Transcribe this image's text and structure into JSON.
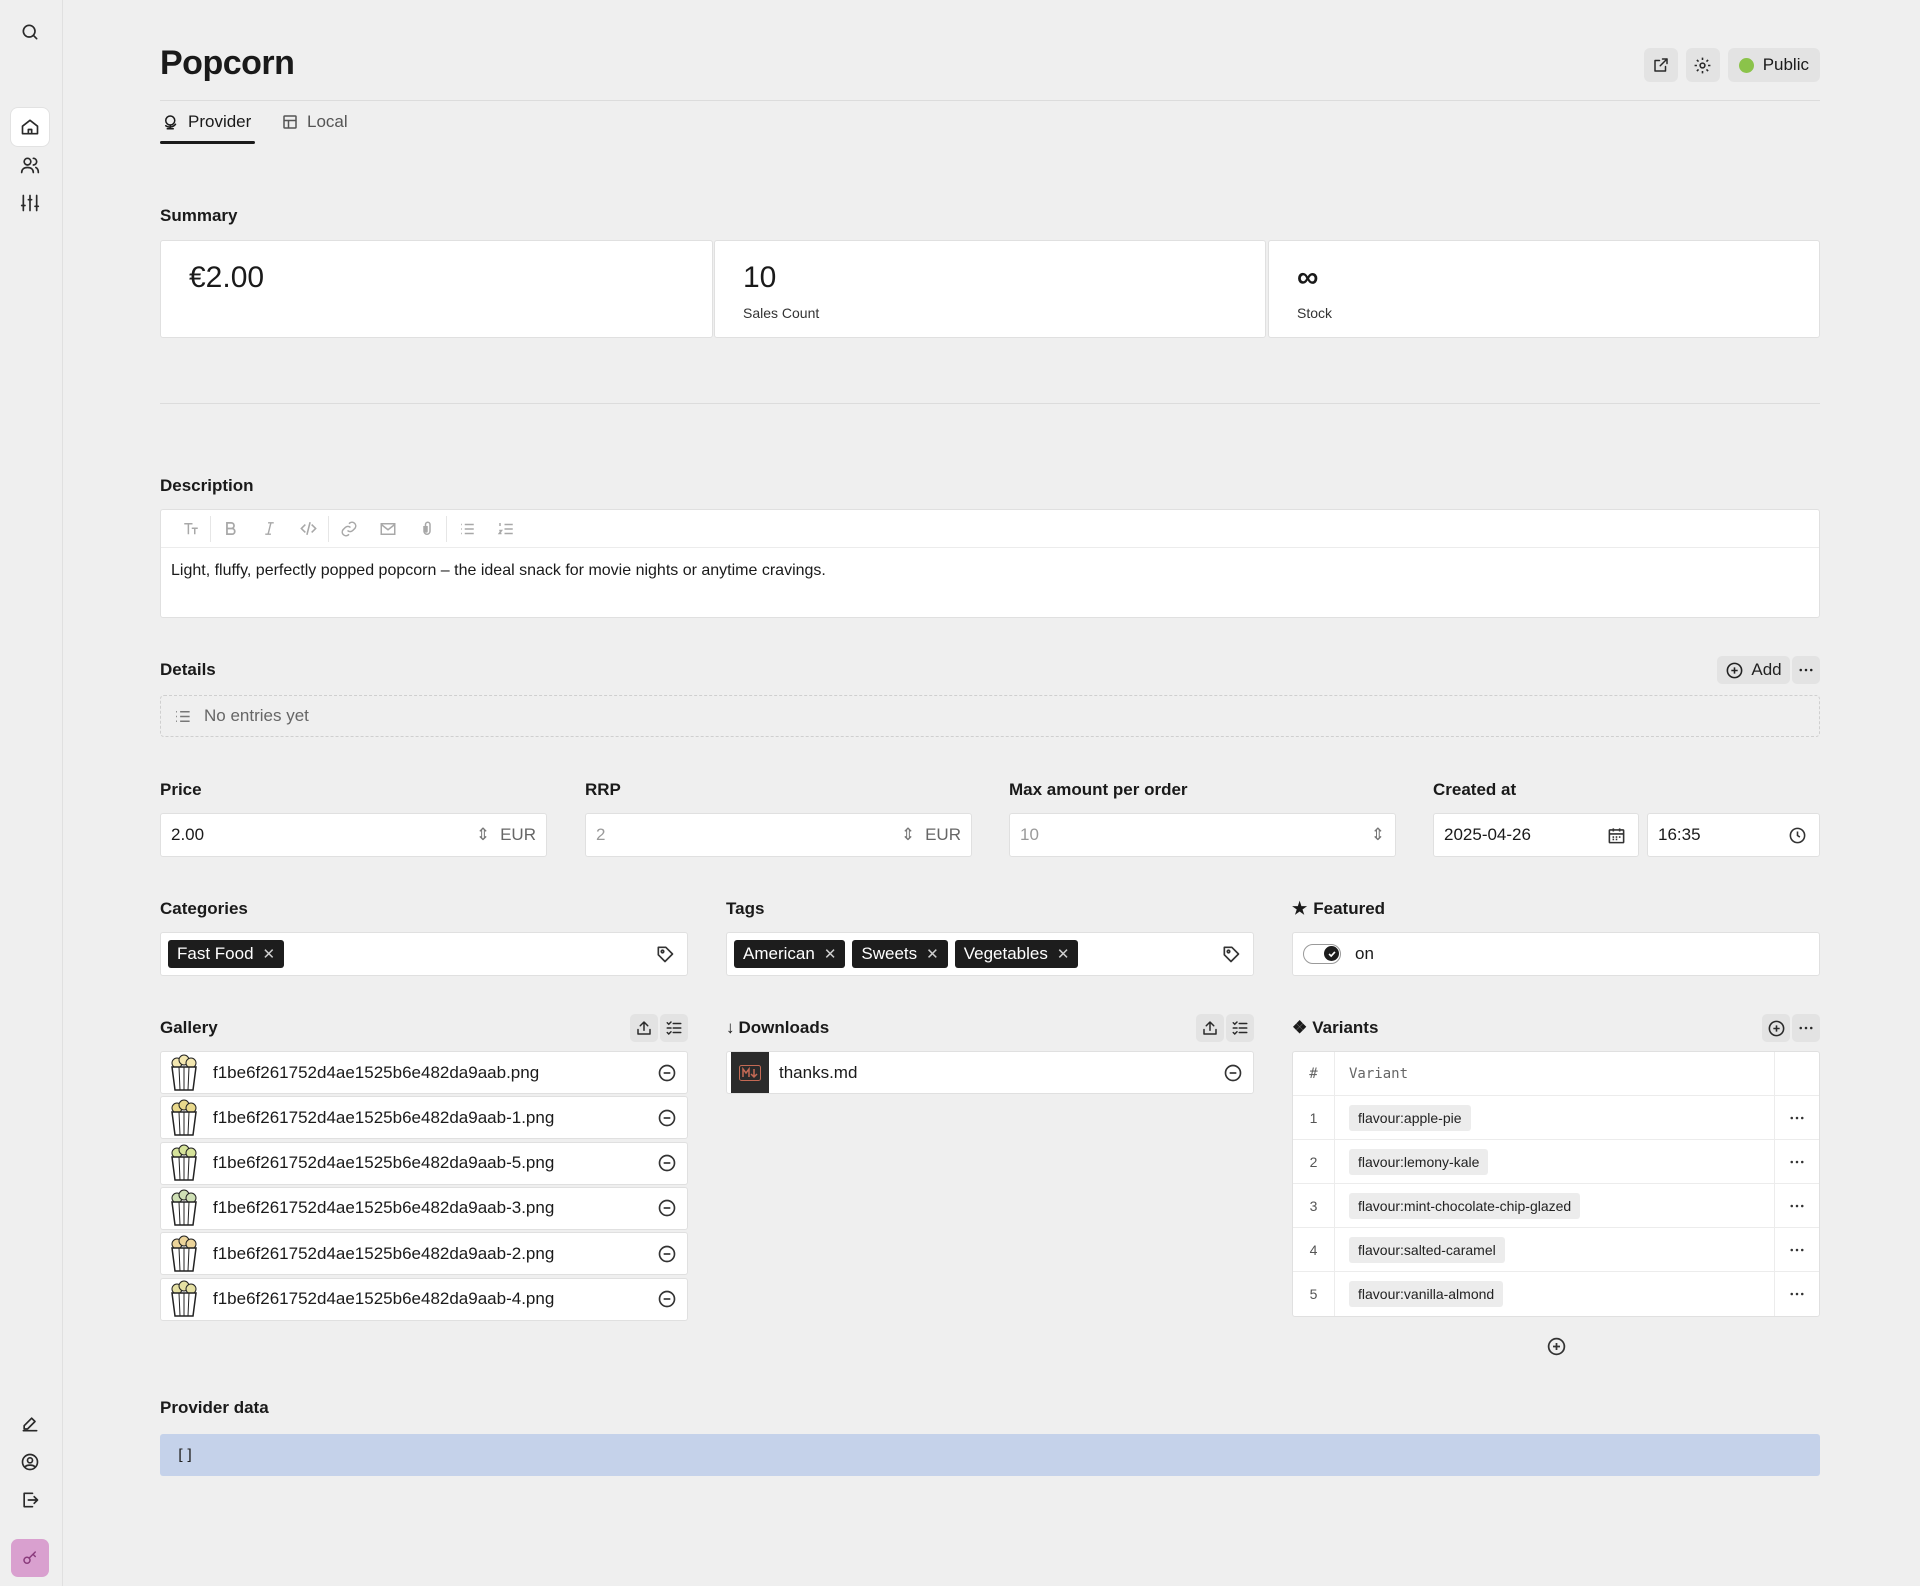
{
  "page": {
    "title": "Popcorn",
    "status": "Public"
  },
  "tabs": [
    {
      "label": "Provider"
    },
    {
      "label": "Local"
    }
  ],
  "summary": {
    "label": "Summary",
    "price": {
      "value": "€2.00"
    },
    "sales": {
      "value": "10",
      "label": "Sales Count"
    },
    "stock": {
      "value": "∞",
      "label": "Stock"
    }
  },
  "description": {
    "label": "Description",
    "text": "Light, fluffy, perfectly popped popcorn – the ideal snack for movie nights or anytime cravings."
  },
  "details": {
    "label": "Details",
    "add_label": "Add",
    "empty_text": "No entries yet"
  },
  "price": {
    "label": "Price",
    "value": "2.00",
    "currency": "EUR"
  },
  "rrp": {
    "label": "RRP",
    "placeholder": "2",
    "currency": "EUR"
  },
  "max_amount": {
    "label": "Max amount per order",
    "placeholder": "10"
  },
  "created_at": {
    "label": "Created at",
    "date": "2025-04-26",
    "time": "16:35"
  },
  "categories": {
    "label": "Categories",
    "items": [
      "Fast Food"
    ]
  },
  "tags": {
    "label": "Tags",
    "items": [
      "American",
      "Sweets",
      "Vegetables"
    ]
  },
  "featured": {
    "label": "Featured",
    "state_label": "on",
    "enabled": true
  },
  "gallery": {
    "label": "Gallery",
    "files": [
      "f1be6f261752d4ae1525b6e482da9aab.png",
      "f1be6f261752d4ae1525b6e482da9aab-1.png",
      "f1be6f261752d4ae1525b6e482da9aab-5.png",
      "f1be6f261752d4ae1525b6e482da9aab-3.png",
      "f1be6f261752d4ae1525b6e482da9aab-2.png",
      "f1be6f261752d4ae1525b6e482da9aab-4.png"
    ]
  },
  "downloads": {
    "label": "Downloads",
    "files": [
      "thanks.md"
    ]
  },
  "variants": {
    "label": "Variants",
    "col_num": "#",
    "col_variant": "Variant",
    "rows": [
      {
        "num": "1",
        "value": "flavour:apple-pie"
      },
      {
        "num": "2",
        "value": "flavour:lemony-kale"
      },
      {
        "num": "3",
        "value": "flavour:mint-chocolate-chip-glazed"
      },
      {
        "num": "4",
        "value": "flavour:salted-caramel"
      },
      {
        "num": "5",
        "value": "flavour:vanilla-almond"
      }
    ]
  },
  "provider_data": {
    "label": "Provider data",
    "value": "[]"
  },
  "icons": {
    "rail": [
      "search-icon",
      "home-icon",
      "users-icon",
      "sliders-icon",
      "pencil-icon",
      "user-circle-icon",
      "logout-icon",
      "key-icon"
    ],
    "top": [
      "external-link-icon",
      "gear-icon"
    ]
  },
  "colors": {
    "status_dot": "#8bc34a",
    "provider_data_bg": "#c5d2ea",
    "brand": "#d9a0cf",
    "chip_bg": "#1d1d1d"
  }
}
